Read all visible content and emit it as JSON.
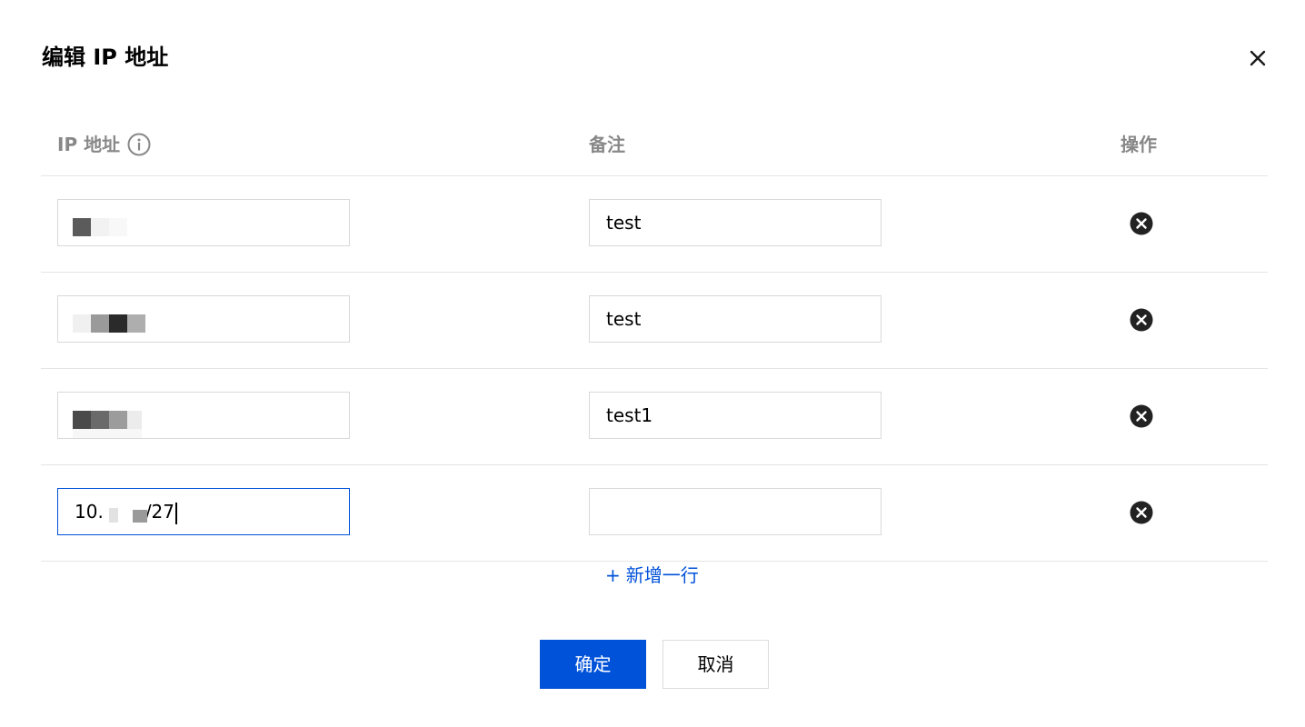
{
  "dialog": {
    "title": "编辑 IP 地址"
  },
  "table": {
    "columns": {
      "ip": "IP 地址",
      "note": "备注",
      "action": "操作"
    },
    "rows": [
      {
        "ip": "",
        "note": "test"
      },
      {
        "ip": "",
        "note": "test"
      },
      {
        "ip": "",
        "note": "test1"
      },
      {
        "ip_prefix": "10.",
        "ip_suffix": "/27",
        "note": ""
      }
    ]
  },
  "add_row_label": "新增一行",
  "add_row_icon": "+",
  "buttons": {
    "ok": "确定",
    "cancel": "取消"
  },
  "colors": {
    "primary": "#0052d9",
    "header_text": "#888888",
    "border": "#e5e5e5"
  },
  "icons": {
    "close": "close-icon",
    "info": "info-circle-icon",
    "remove": "close-circle-filled-icon"
  }
}
